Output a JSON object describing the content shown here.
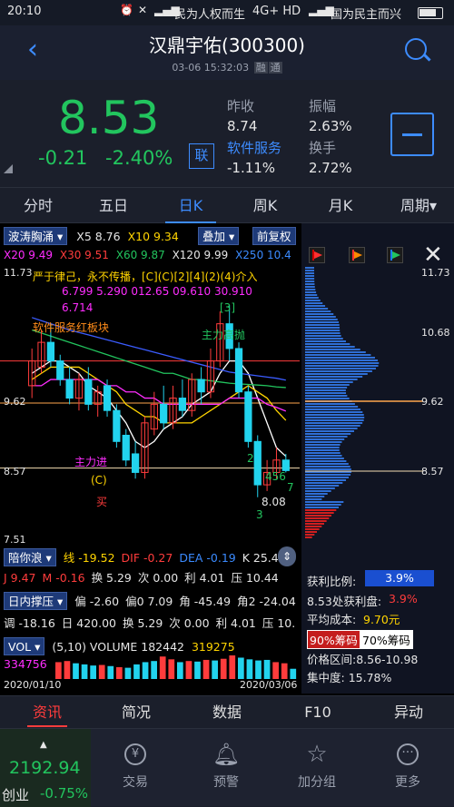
{
  "status_bar": {
    "time": "20:10",
    "carrier1": "民为人权而生",
    "net": "4G+ HD",
    "carrier2": "国为民主而兴",
    "battery_icon": "battery-icon"
  },
  "header": {
    "title": "汉鼎宇佑(300300)",
    "datetime": "03-06 15:32:03",
    "badge1": "融",
    "badge2": "通",
    "back_icon": "back-chevron-icon",
    "search_icon": "search-icon"
  },
  "quote": {
    "price": "8.53",
    "change": "-0.21",
    "change_pct": "-2.40%",
    "link_btn": "联",
    "prev_close_label": "昨收",
    "prev_close": "8.74",
    "amplitude_label": "振幅",
    "amplitude": "2.63%",
    "sector_label": "软件服务",
    "sector_change": "-1.11%",
    "turnover_label": "换手",
    "turnover": "2.72%"
  },
  "tabs": [
    "分时",
    "五日",
    "日K",
    "周K",
    "月K",
    "周期▾"
  ],
  "active_tab": 2,
  "chart": {
    "indicator_name": "波涛胸涌",
    "top_line1": [
      "X5 8.76",
      "X10 9.34"
    ],
    "overlay_btn": "叠加",
    "adjust_btn": "前复权",
    "top_line2": [
      "X20 9.49",
      "X30 9.51",
      "X60 9.87",
      "X120 9.99",
      "X250 10.4"
    ],
    "prices": {
      "high": "11.73",
      "p2": "10.68",
      "p3": "9.62",
      "p4": "8.57",
      "low": "7.51"
    },
    "annot_warn": "严于律己，永不传播，[C](C)[2][4](2)(4)介入",
    "annot_nums1": "6.799   5.290  012.65 09.610 30.910",
    "annot_nums2": "6.714",
    "annot_sector": "软件服务红板块",
    "annot_main_up": "主力高抛",
    "annot_main_in": "主力进",
    "annot_C": "(C)",
    "annot_buy": "买",
    "annot_808": "8.08",
    "annot_3": "3",
    "annot_3b": "[3]",
    "annot_2": "2",
    "annot_456": "456",
    "annot_7": "7",
    "annot_seq": "3 4 5 6 7 8",
    "dist": {
      "high": "11.73",
      "p2": "10.68",
      "p3": "9.62",
      "p4": "8.57",
      "ratio_label": "获利比例:",
      "ratio": "3.9%",
      "profit_label": "8.53处获利盘:",
      "profit": "3.9%",
      "avg_label": "平均成本:",
      "avg": "9.70元",
      "chip90": "90%筹码",
      "chip70": "70%筹码",
      "range_label": "价格区间:",
      "range": "8.56-10.98",
      "conc_label": "集中度:",
      "conc": "15.78%"
    }
  },
  "indicators": {
    "ind2_name": "陪你浪",
    "ind2_line1": "线 -19.52",
    "ind2_dif": "DIF -0.27",
    "ind2_dea": "DEA -0.19",
    "ind2_k": "K 25.44",
    "ind2_line2": [
      "J 9.47",
      "M -0.16",
      "换 5.29",
      "次 0.00",
      "利 4.01",
      "压 10.44"
    ],
    "ind3_name": "日内撑压",
    "ind3_line1": [
      "偏 -2.60",
      "偏0 7.09",
      "角 -45.49",
      "角2 -24.04"
    ],
    "ind3_line2": [
      "调 -18.16",
      "日 420.00",
      "换 5.29",
      "次 0.00",
      "利 4.01",
      "压 10."
    ],
    "vol_name": "VOL",
    "vol_line": "(5,10) VOLUME 182442",
    "vol_ma5": "319275",
    "vol_ma10": "334756",
    "date_start": "2020/01/10",
    "date_end": "2020/03/06"
  },
  "nav_tabs": [
    "资讯",
    "简况",
    "数据",
    "F10",
    "异动"
  ],
  "bottom": {
    "index_value": "2192.94",
    "index_name": "创业",
    "index_change": "-0.75%",
    "buttons": [
      "交易",
      "预警",
      "加分组",
      "更多"
    ]
  },
  "chart_data": {
    "type": "candlestick",
    "ylim": [
      7.51,
      11.73
    ],
    "ticks": [
      "11.73",
      "10.68",
      "9.62",
      "8.57",
      "7.51"
    ],
    "candles": [
      {
        "o": 9.9,
        "c": 10.3,
        "h": 10.5,
        "l": 9.7
      },
      {
        "o": 10.2,
        "c": 10.6,
        "h": 10.8,
        "l": 10.1
      },
      {
        "o": 10.6,
        "c": 10.3,
        "h": 10.9,
        "l": 10.2
      },
      {
        "o": 10.3,
        "c": 10.0,
        "h": 10.4,
        "l": 9.9
      },
      {
        "o": 10.0,
        "c": 9.7,
        "h": 10.2,
        "l": 9.6
      },
      {
        "o": 9.7,
        "c": 10.0,
        "h": 10.1,
        "l": 9.5
      },
      {
        "o": 10.0,
        "c": 9.6,
        "h": 10.2,
        "l": 9.5
      },
      {
        "o": 9.6,
        "c": 9.8,
        "h": 9.9,
        "l": 9.4
      },
      {
        "o": 9.9,
        "c": 9.5,
        "h": 10.0,
        "l": 9.4
      },
      {
        "o": 9.5,
        "c": 9.0,
        "h": 9.6,
        "l": 8.9
      },
      {
        "o": 9.1,
        "c": 8.7,
        "h": 9.2,
        "l": 8.6
      },
      {
        "o": 8.8,
        "c": 8.5,
        "h": 9.0,
        "l": 8.4
      },
      {
        "o": 8.5,
        "c": 9.3,
        "h": 9.4,
        "l": 8.4
      },
      {
        "o": 9.2,
        "c": 9.6,
        "h": 9.8,
        "l": 9.1
      },
      {
        "o": 9.6,
        "c": 9.3,
        "h": 9.9,
        "l": 9.2
      },
      {
        "o": 9.3,
        "c": 9.7,
        "h": 9.9,
        "l": 9.2
      },
      {
        "o": 9.7,
        "c": 9.5,
        "h": 10.0,
        "l": 9.4
      },
      {
        "o": 9.5,
        "c": 10.0,
        "h": 10.1,
        "l": 9.4
      },
      {
        "o": 10.0,
        "c": 9.8,
        "h": 10.2,
        "l": 9.6
      },
      {
        "o": 9.8,
        "c": 10.3,
        "h": 10.5,
        "l": 9.7
      },
      {
        "o": 10.3,
        "c": 10.9,
        "h": 11.1,
        "l": 10.2
      },
      {
        "o": 10.9,
        "c": 10.5,
        "h": 11.2,
        "l": 10.3
      },
      {
        "o": 10.5,
        "c": 9.8,
        "h": 10.6,
        "l": 9.7
      },
      {
        "o": 9.8,
        "c": 9.0,
        "h": 9.9,
        "l": 8.9
      },
      {
        "o": 9.0,
        "c": 8.3,
        "h": 9.1,
        "l": 8.1
      },
      {
        "o": 8.3,
        "c": 8.5,
        "h": 8.7,
        "l": 8.2
      },
      {
        "o": 8.5,
        "c": 8.7,
        "h": 8.9,
        "l": 8.4
      },
      {
        "o": 8.7,
        "c": 8.53,
        "h": 8.8,
        "l": 8.5
      }
    ],
    "ma_lines": [
      {
        "name": "X5",
        "color": "#ffffff",
        "values": [
          10.1,
          10.2,
          10.3,
          10.3,
          10.2,
          10.1,
          9.9,
          9.8,
          9.7,
          9.5,
          9.3,
          9.0,
          8.9,
          9.0,
          9.2,
          9.3,
          9.4,
          9.6,
          9.7,
          9.8,
          10.1,
          10.3,
          10.3,
          10.1,
          9.7,
          9.3,
          8.9,
          8.76
        ]
      },
      {
        "name": "X10",
        "color": "#ffd400",
        "values": [
          10.0,
          10.1,
          10.2,
          10.2,
          10.2,
          10.2,
          10.1,
          10.0,
          9.9,
          9.8,
          9.6,
          9.5,
          9.4,
          9.4,
          9.3,
          9.3,
          9.3,
          9.3,
          9.4,
          9.5,
          9.6,
          9.7,
          9.8,
          9.9,
          9.8,
          9.7,
          9.5,
          9.34
        ]
      },
      {
        "name": "X20",
        "color": "#ff2dff",
        "values": [
          9.9,
          9.9,
          10.0,
          10.0,
          10.0,
          10.0,
          10.0,
          10.0,
          9.9,
          9.9,
          9.8,
          9.8,
          9.7,
          9.7,
          9.6,
          9.6,
          9.6,
          9.6,
          9.6,
          9.6,
          9.6,
          9.7,
          9.7,
          9.7,
          9.7,
          9.6,
          9.55,
          9.49
        ]
      },
      {
        "name": "X60",
        "color": "#22c55e",
        "values": [
          10.8,
          10.75,
          10.7,
          10.65,
          10.6,
          10.55,
          10.5,
          10.45,
          10.4,
          10.35,
          10.3,
          10.25,
          10.2,
          10.15,
          10.1,
          10.1,
          10.05,
          10.0,
          10.0,
          9.98,
          9.96,
          9.94,
          9.93,
          9.92,
          9.91,
          9.9,
          9.88,
          9.87
        ]
      },
      {
        "name": "X120",
        "color": "#3b5cff",
        "values": [
          11.0,
          10.95,
          10.9,
          10.85,
          10.8,
          10.76,
          10.72,
          10.68,
          10.64,
          10.6,
          10.56,
          10.52,
          10.48,
          10.44,
          10.4,
          10.36,
          10.32,
          10.28,
          10.24,
          10.2,
          10.16,
          10.12,
          10.1,
          10.08,
          10.06,
          10.04,
          10.02,
          9.99
        ]
      }
    ],
    "volume": [
      300,
      320,
      280,
      260,
      240,
      250,
      230,
      210,
      200,
      260,
      300,
      320,
      400,
      350,
      300,
      320,
      310,
      340,
      330,
      360,
      420,
      380,
      350,
      330,
      340,
      300,
      280,
      182
    ]
  }
}
